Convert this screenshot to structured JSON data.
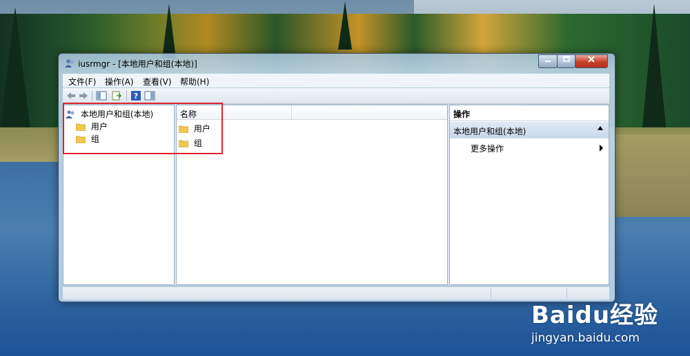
{
  "window": {
    "title": "iusrmgr - [本地用户和组(本地)]"
  },
  "menubar": {
    "items": [
      "文件(F)",
      "操作(A)",
      "查看(V)",
      "帮助(H)"
    ]
  },
  "tree": {
    "root": "本地用户和组(本地)",
    "children": [
      "用户",
      "组"
    ]
  },
  "list": {
    "column_name": "名称",
    "rows": [
      "用户",
      "组"
    ]
  },
  "actions": {
    "title": "操作",
    "group_label": "本地用户和组(本地)",
    "more_actions": "更多操作"
  },
  "watermark": {
    "logo": "Baidu经验",
    "url": "jingyan.baidu.com"
  },
  "colors": {
    "highlight": "#e0202a",
    "folder": "#f0c850",
    "close_button": "#c4402a"
  }
}
